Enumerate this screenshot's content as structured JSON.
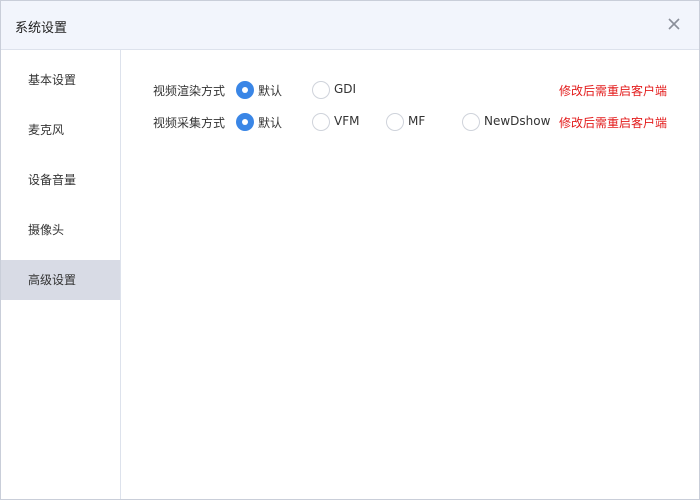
{
  "window": {
    "title": "系统设置",
    "close_icon": "close-icon"
  },
  "sidebar": {
    "items": [
      {
        "label": "基本设置",
        "active": false
      },
      {
        "label": "麦克风",
        "active": false
      },
      {
        "label": "设备音量",
        "active": false
      },
      {
        "label": "摄像头",
        "active": false
      },
      {
        "label": "高级设置",
        "active": true
      }
    ]
  },
  "settings": {
    "render": {
      "label": "视频渲染方式",
      "options": [
        {
          "label": "默认",
          "checked": true
        },
        {
          "label": "GDI",
          "checked": false
        }
      ],
      "note": "修改后需重启客户端"
    },
    "capture": {
      "label": "视频采集方式",
      "options": [
        {
          "label": "默认",
          "checked": true
        },
        {
          "label": "VFM",
          "checked": false
        },
        {
          "label": "MF",
          "checked": false
        },
        {
          "label": "NewDshow",
          "checked": false
        }
      ],
      "note": "修改后需重启客户端"
    }
  },
  "colors": {
    "accent": "#3a86e6",
    "warning": "#e31c1c",
    "titlebar_bg": "#f2f5fc",
    "active_nav_bg": "#d8dbe5"
  }
}
